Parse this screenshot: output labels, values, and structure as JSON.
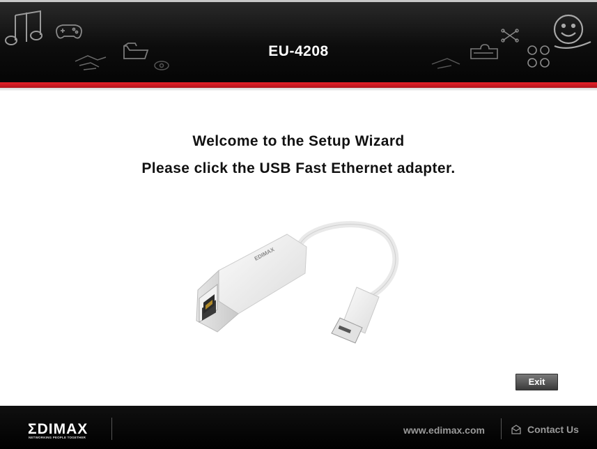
{
  "header": {
    "product_title": "EU-4208",
    "icons": [
      "music-notes-icon",
      "gamepad-icon",
      "handshake-icon",
      "folder-icon",
      "eye-icon",
      "network-nodes-icon",
      "puzzle-icon",
      "smiley-icon",
      "bubbles-icon"
    ]
  },
  "main": {
    "welcome_line1": "Welcome to the Setup Wizard",
    "welcome_line2": "Please click the USB Fast Ethernet adapter.",
    "product_image_label": "EDIMAX",
    "exit_label": "Exit"
  },
  "footer": {
    "logo_text": "ΣDIMAX",
    "logo_tagline": "NETWORKING PEOPLE TOGETHER",
    "website": "www.edimax.com",
    "contact_label": "Contact Us"
  },
  "colors": {
    "header_bg": "#0d0d0d",
    "accent_red": "#d81c24",
    "footer_bg": "#050505",
    "exit_button": "#4a4a4a"
  }
}
